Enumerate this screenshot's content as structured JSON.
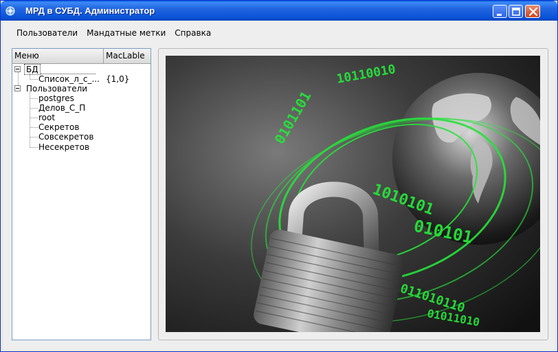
{
  "window": {
    "title": "МРД в СУБД. Администратор"
  },
  "menubar": {
    "items": [
      "Пользователи",
      "Мандатные метки",
      "Справка"
    ]
  },
  "tree": {
    "columns": [
      "Меню",
      "MacLable"
    ],
    "nodes": [
      {
        "label": "БД",
        "value": ""
      },
      {
        "label": "Список_л_с_...",
        "value": "{1,0}"
      },
      {
        "label": "Пользователи",
        "value": ""
      },
      {
        "label": "postgres",
        "value": ""
      },
      {
        "label": "Делов_С_П",
        "value": ""
      },
      {
        "label": "root",
        "value": ""
      },
      {
        "label": "Секретов",
        "value": ""
      },
      {
        "label": "Совсекретов",
        "value": ""
      },
      {
        "label": "Несекретов",
        "value": ""
      }
    ]
  },
  "colors": {
    "titlebar": "#0B55D8",
    "accent_green": "#27E23A"
  },
  "icons": {
    "app": "app-icon",
    "minimize": "minimize-icon",
    "maximize": "maximize-icon",
    "close": "close-icon",
    "image": "padlock-globe-image"
  }
}
